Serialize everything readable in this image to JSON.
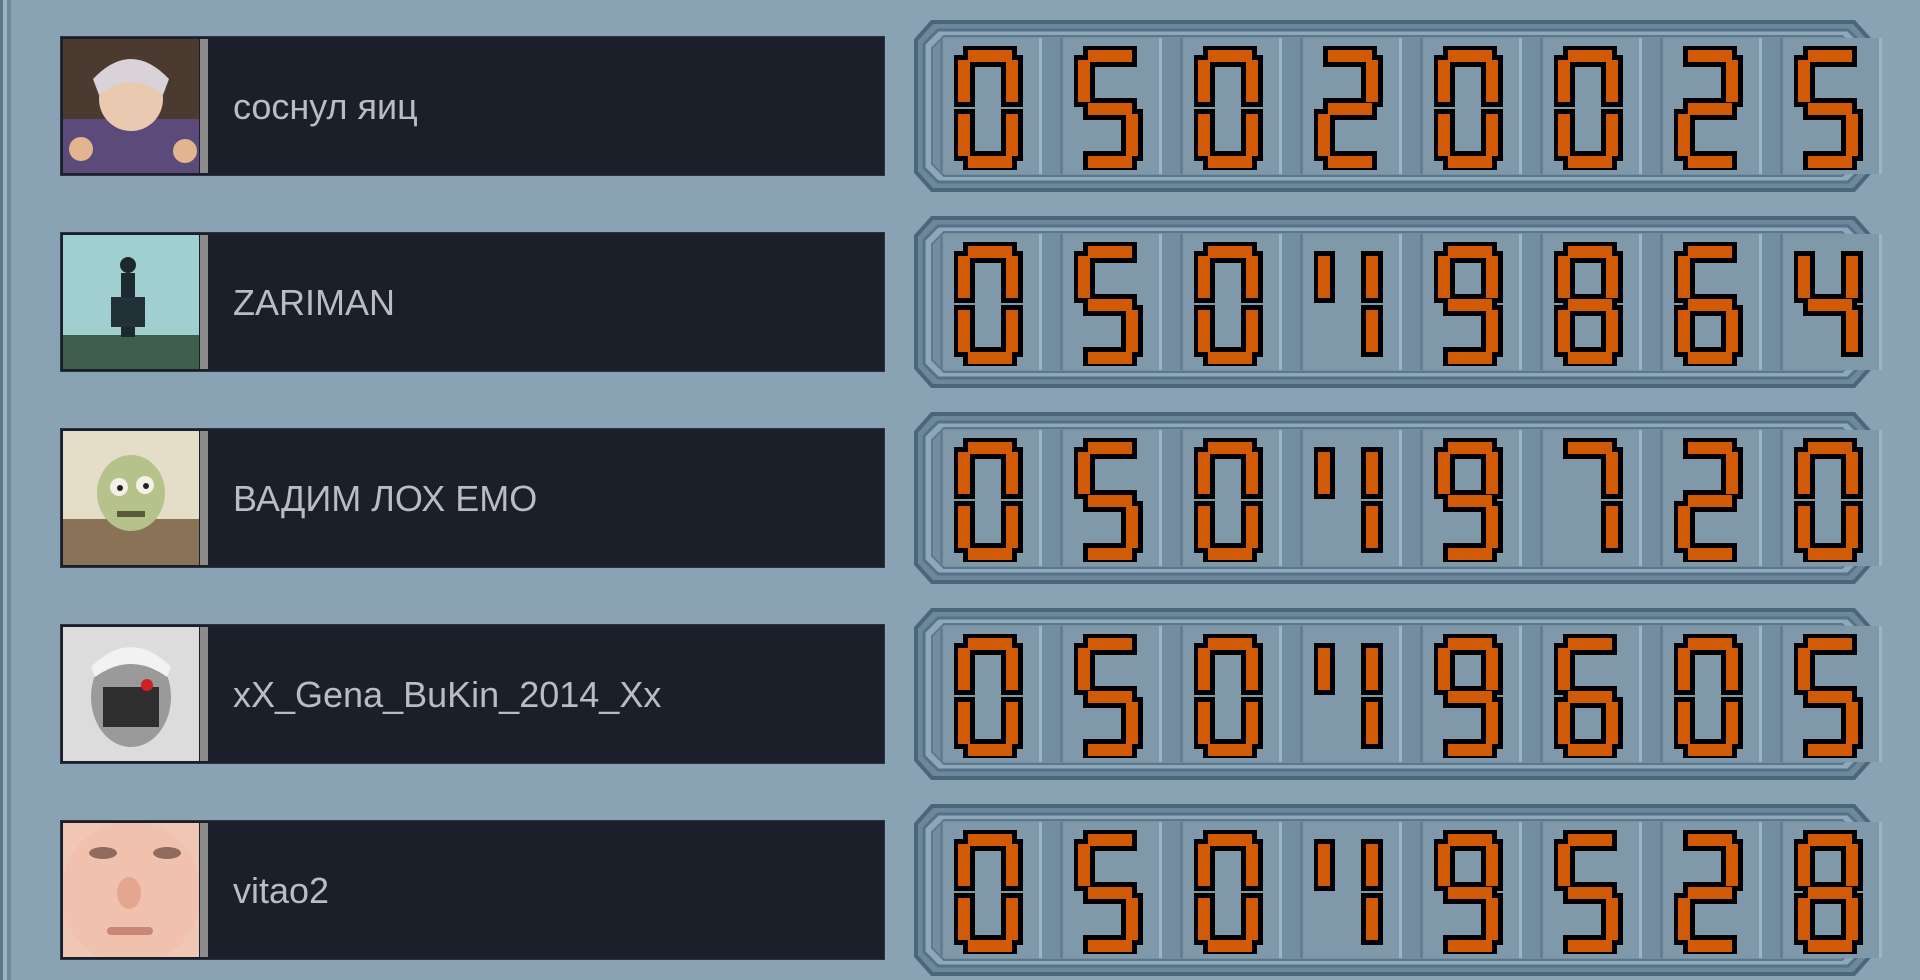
{
  "players": [
    {
      "name": "соснул яиц",
      "score_digits": [
        "0",
        "5",
        "0",
        "2",
        "0",
        "0",
        "2",
        "5"
      ],
      "avatar_icon": "anime-character-avatar"
    },
    {
      "name": "ZARIMAN",
      "score_digits": [
        "0",
        "5",
        "0",
        "1",
        "9",
        "8",
        "6",
        "4"
      ],
      "avatar_icon": "figure-on-cliff-avatar"
    },
    {
      "name": "ВАДИМ ЛОХ ЕМО",
      "score_digits": [
        "0",
        "5",
        "0",
        "1",
        "9",
        "7",
        "2",
        "0"
      ],
      "avatar_icon": "cartoon-zombie-avatar"
    },
    {
      "name": "xX_Gena_BuKin_2014_Xx",
      "score_digits": [
        "0",
        "5",
        "0",
        "1",
        "9",
        "6",
        "0",
        "5"
      ],
      "avatar_icon": "masked-face-avatar"
    },
    {
      "name": "vitao2",
      "score_digits": [
        "0",
        "5",
        "0",
        "1",
        "9",
        "5",
        "2",
        "8"
      ],
      "avatar_icon": "face-closeup-avatar"
    }
  ],
  "colors": {
    "background": "#89a2b4",
    "panel": "#1b1f29",
    "name_text": "#b9bcc1",
    "digit_fill": "#d05a05",
    "digit_outline": "#000000"
  }
}
